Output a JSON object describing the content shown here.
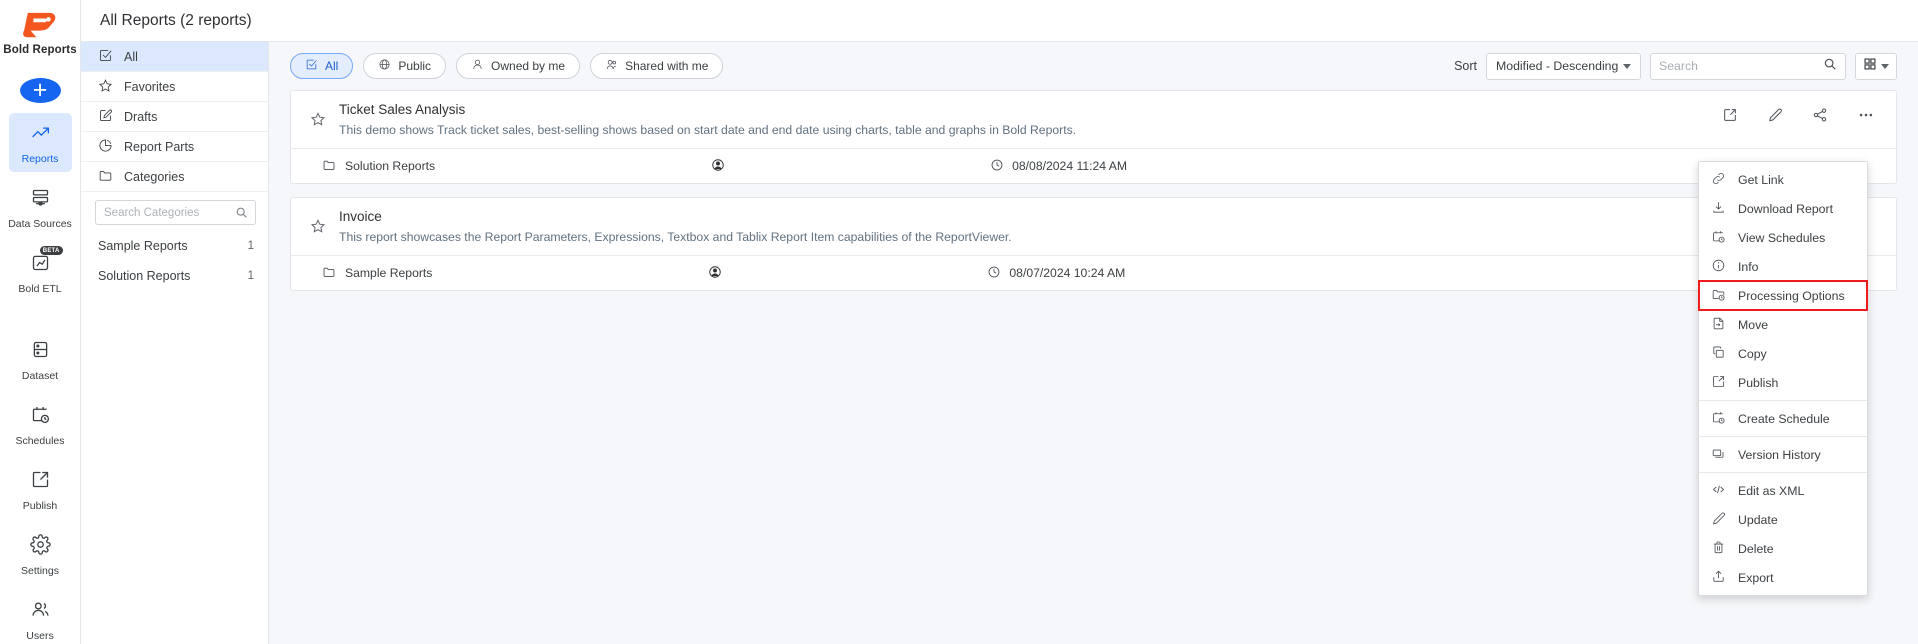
{
  "rail": {
    "brand": {
      "label": "Bold Reports",
      "icon": "bold-reports-logo"
    },
    "add_button": {
      "label": "+",
      "icon": "plus-icon"
    },
    "items": [
      {
        "label": "Reports",
        "icon": "trending-up-icon",
        "active": true
      },
      {
        "label": "Data Sources",
        "icon": "database-icon",
        "active": false
      },
      {
        "label": "Bold ETL",
        "icon": "etl-icon",
        "badge": "BETA",
        "active": false
      },
      {
        "label": "Dataset",
        "icon": "dataset-icon",
        "active": false
      },
      {
        "label": "Schedules",
        "icon": "calendar-clock-icon",
        "active": false
      },
      {
        "label": "Publish",
        "icon": "publish-icon",
        "active": false
      },
      {
        "label": "Settings",
        "icon": "gear-icon",
        "active": false
      },
      {
        "label": "Users",
        "icon": "users-icon",
        "active": false
      }
    ]
  },
  "header": {
    "title": "All Reports (2 reports)"
  },
  "nav": {
    "items": [
      {
        "label": "All",
        "icon": "checkbox-icon",
        "active": true
      },
      {
        "label": "Favorites",
        "icon": "star-icon",
        "active": false
      },
      {
        "label": "Drafts",
        "icon": "draft-pencil-icon",
        "active": false
      },
      {
        "label": "Report Parts",
        "icon": "pie-chart-icon",
        "active": false
      },
      {
        "label": "Categories",
        "icon": "folder-icon",
        "active": false
      }
    ],
    "search": {
      "placeholder": "Search Categories",
      "value": "",
      "icon": "search-icon"
    },
    "categories": [
      {
        "label": "Sample Reports",
        "count": "1"
      },
      {
        "label": "Solution Reports",
        "count": "1"
      }
    ]
  },
  "toolbar": {
    "chips": [
      {
        "label": "All",
        "icon": "checkbox-icon",
        "active": true
      },
      {
        "label": "Public",
        "icon": "globe-icon",
        "active": false
      },
      {
        "label": "Owned by me",
        "icon": "user-icon",
        "active": false
      },
      {
        "label": "Shared with me",
        "icon": "users-share-icon",
        "active": false
      }
    ],
    "sort_label": "Sort",
    "sort_value": "Modified - Descending",
    "search": {
      "placeholder": "Search",
      "value": "",
      "icon": "search-icon"
    },
    "view_toggle": {
      "icon": "grid-view-icon"
    }
  },
  "cards": [
    {
      "title": "Ticket Sales Analysis",
      "description": "This demo shows Track ticket sales, best-selling shows based on start date and end date using charts, table and graphs in Bold Reports.",
      "category": "Solution Reports",
      "category_icon": "folder-icon",
      "owner_icon": "owner-avatar-icon",
      "date": "08/08/2024 11:24 AM",
      "date_icon": "clock-icon",
      "favorite_icon": "star-outline-icon",
      "actions": [
        {
          "icon": "open-external-icon"
        },
        {
          "icon": "edit-pencil-icon"
        },
        {
          "icon": "share-icon"
        },
        {
          "icon": "more-options-icon"
        }
      ]
    },
    {
      "title": "Invoice",
      "description": "This report showcases the Report Parameters, Expressions, Textbox and Tablix Report Item capabilities of the ReportViewer.",
      "category": "Sample Reports",
      "category_icon": "folder-icon",
      "owner_icon": "owner-avatar-icon",
      "date": "08/07/2024 10:24 AM",
      "date_icon": "clock-icon",
      "favorite_icon": "star-outline-icon",
      "actions": []
    }
  ],
  "context_menu": {
    "items": [
      {
        "label": "Get Link",
        "icon": "link-icon",
        "highlighted": false,
        "separator_after": false
      },
      {
        "label": "Download Report",
        "icon": "download-icon",
        "highlighted": false,
        "separator_after": false
      },
      {
        "label": "View Schedules",
        "icon": "calendar-clock-icon",
        "highlighted": false,
        "separator_after": false
      },
      {
        "label": "Info",
        "icon": "info-icon",
        "highlighted": false,
        "separator_after": false
      },
      {
        "label": "Processing Options",
        "icon": "processing-folder-icon",
        "highlighted": true,
        "separator_after": false
      },
      {
        "label": "Move",
        "icon": "move-file-icon",
        "highlighted": false,
        "separator_after": false
      },
      {
        "label": "Copy",
        "icon": "copy-icon",
        "highlighted": false,
        "separator_after": false
      },
      {
        "label": "Publish",
        "icon": "publish-icon",
        "highlighted": false,
        "separator_after": true
      },
      {
        "label": "Create Schedule",
        "icon": "calendar-clock-icon",
        "highlighted": false,
        "separator_after": true
      },
      {
        "label": "Version History",
        "icon": "version-history-icon",
        "highlighted": false,
        "separator_after": true
      },
      {
        "label": "Edit as XML",
        "icon": "code-icon",
        "highlighted": false,
        "separator_after": false
      },
      {
        "label": "Update",
        "icon": "edit-pencil-icon",
        "highlighted": false,
        "separator_after": false
      },
      {
        "label": "Delete",
        "icon": "trash-icon",
        "highlighted": false,
        "separator_after": false
      },
      {
        "label": "Export",
        "icon": "export-icon",
        "highlighted": false,
        "separator_after": false
      }
    ],
    "highlight_color": "#f01c1c"
  },
  "colors": {
    "accent": "#1565f0",
    "brand": "#f4561f",
    "active_bg": "#dbe8fd",
    "canvas": "#f5f7fa"
  }
}
